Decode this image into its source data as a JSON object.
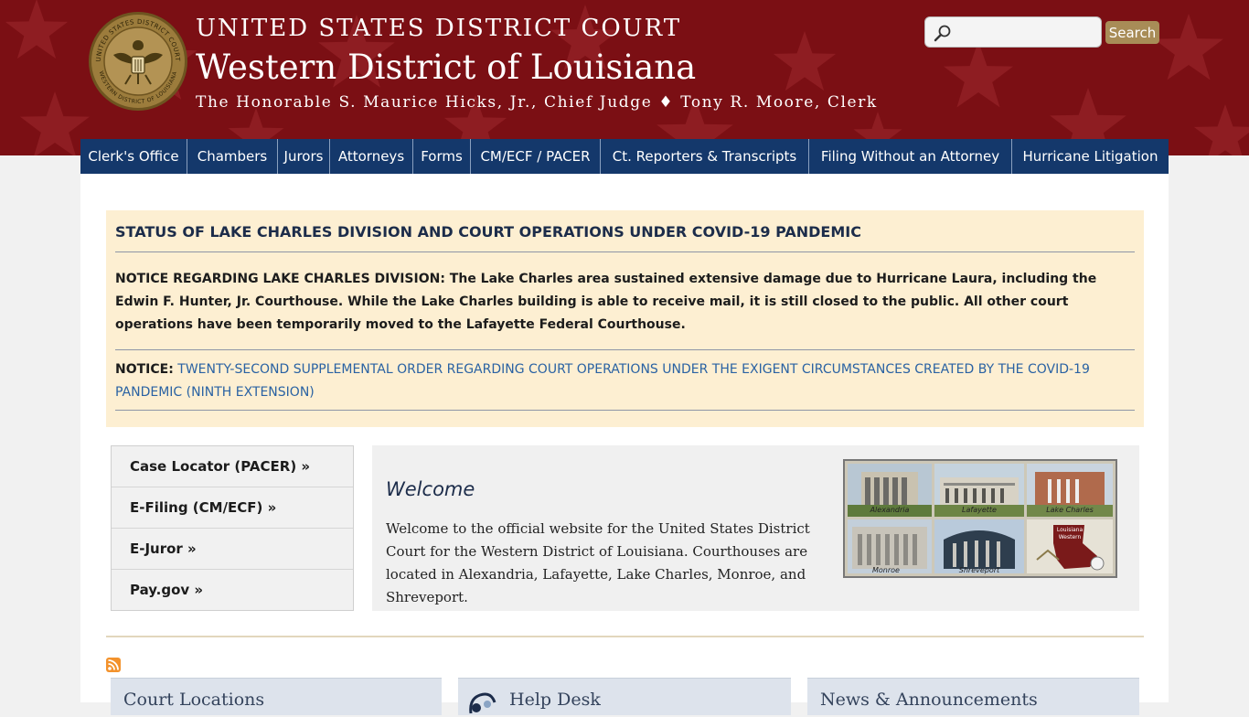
{
  "header": {
    "court_name": "UNITED STATES DISTRICT COURT",
    "district_name": "Western District of Louisiana",
    "judges_line": "The Honorable S. Maurice Hicks, Jr., Chief Judge ♦ Tony R. Moore, Clerk",
    "seal": {
      "top_text": "UNITED STATES DISTRICT COURT",
      "bottom_text": "WESTERN DISTRICT OF LOUISIANA"
    }
  },
  "search": {
    "placeholder": "",
    "value": "",
    "button_label": "Search"
  },
  "nav": {
    "items": [
      {
        "label": "Clerk's Office"
      },
      {
        "label": "Chambers"
      },
      {
        "label": "Jurors"
      },
      {
        "label": "Attorneys"
      },
      {
        "label": "Forms"
      },
      {
        "label": "CM/ECF / PACER"
      },
      {
        "label": "Ct. Reporters & Transcripts"
      },
      {
        "label": "Filing Without an Attorney"
      },
      {
        "label": "Hurricane Litigation"
      }
    ]
  },
  "notice": {
    "title": "STATUS OF LAKE CHARLES DIVISION AND COURT OPERATIONS UNDER COVID-19 PANDEMIC",
    "body": "NOTICE REGARDING LAKE CHARLES DIVISION: The Lake Charles area sustained extensive damage due to Hurricane Laura, including the Edwin F. Hunter, Jr. Courthouse. While the Lake Charles building is able to receive mail, it is still closed to the public. All other court operations have been temporarily moved to the Lafayette Federal Courthouse.",
    "link_prefix": "NOTICE:",
    "link_text": "TWENTY-SECOND SUPPLEMENTAL ORDER REGARDING COURT OPERATIONS UNDER THE EXIGENT CIRCUMSTANCES CREATED BY THE COVID-19 PANDEMIC (NINTH EXTENSION)"
  },
  "quick_links": [
    {
      "label": "Case Locator (PACER) »"
    },
    {
      "label": "E-Filing (CM/ECF) »"
    },
    {
      "label": "E-Juror »"
    },
    {
      "label": "Pay.gov »"
    }
  ],
  "welcome": {
    "title": "Welcome",
    "text": "Welcome to the official website for the United States District Court for the Western District of Louisiana.  Courthouses are located in Alexandria, Lafayette, Lake Charles, Monroe, and Shreveport."
  },
  "collage": {
    "captions": [
      "Alexandria",
      "Lafayette",
      "Lake Charles",
      "Monroe",
      "Shreveport"
    ],
    "map_label_top": "Louisiana",
    "map_label_bottom": "Western"
  },
  "cards": [
    {
      "title": "Court Locations"
    },
    {
      "title": "Help Desk"
    },
    {
      "title": "News & Announcements"
    }
  ],
  "colors": {
    "header_red": "#7b0f14",
    "nav_blue": "#14386b",
    "notice_bg": "#fdefd2",
    "link_blue": "#2a62a3",
    "search_button": "#a88c57"
  }
}
